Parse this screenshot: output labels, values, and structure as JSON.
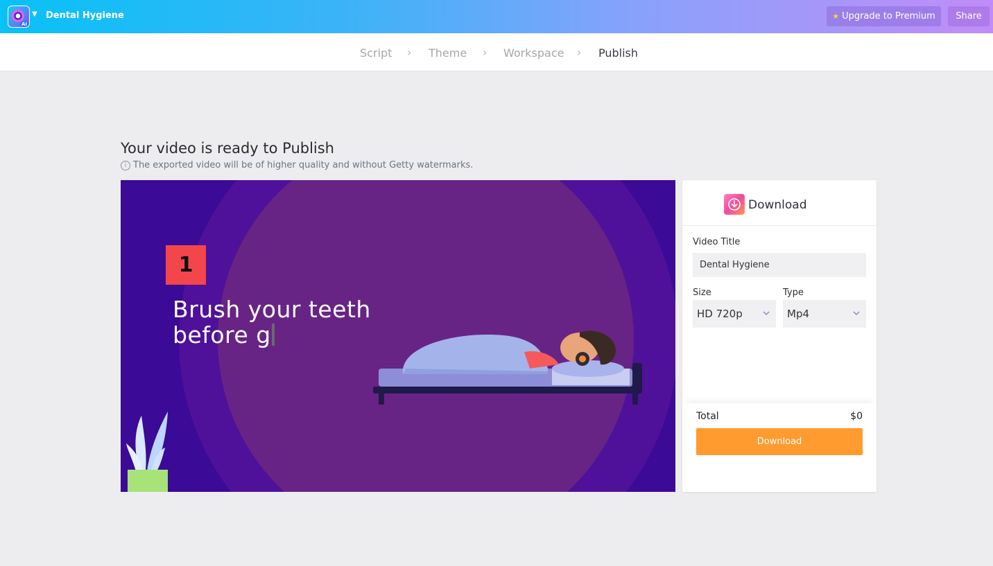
{
  "app": {
    "title": "Dental Hygiene",
    "logo_badge": "AI",
    "upgrade_label": "Upgrade to Premium",
    "share_label": "Share"
  },
  "steps": [
    {
      "label": "Script",
      "active": false
    },
    {
      "label": "Theme",
      "active": false
    },
    {
      "label": "Workspace",
      "active": false
    },
    {
      "label": "Publish",
      "active": true
    }
  ],
  "main": {
    "heading": "Your video is ready to Publish",
    "note": "The exported video will be of higher quality and without Getty watermarks."
  },
  "preview": {
    "badge_number": "1",
    "line1": "Brush your teeth",
    "line2": "before g"
  },
  "download": {
    "title": "Download",
    "video_title_label": "Video Title",
    "video_title_value": "Dental Hygiene",
    "size_label": "Size",
    "size_value": "HD 720p",
    "type_label": "Type",
    "type_value": "Mp4",
    "total_label": "Total",
    "total_value": "$0",
    "button_label": "Download"
  },
  "colors": {
    "accent_orange": "#ff9b2f",
    "video_bg": "#3b0a96",
    "badge_red": "#f3464b"
  }
}
